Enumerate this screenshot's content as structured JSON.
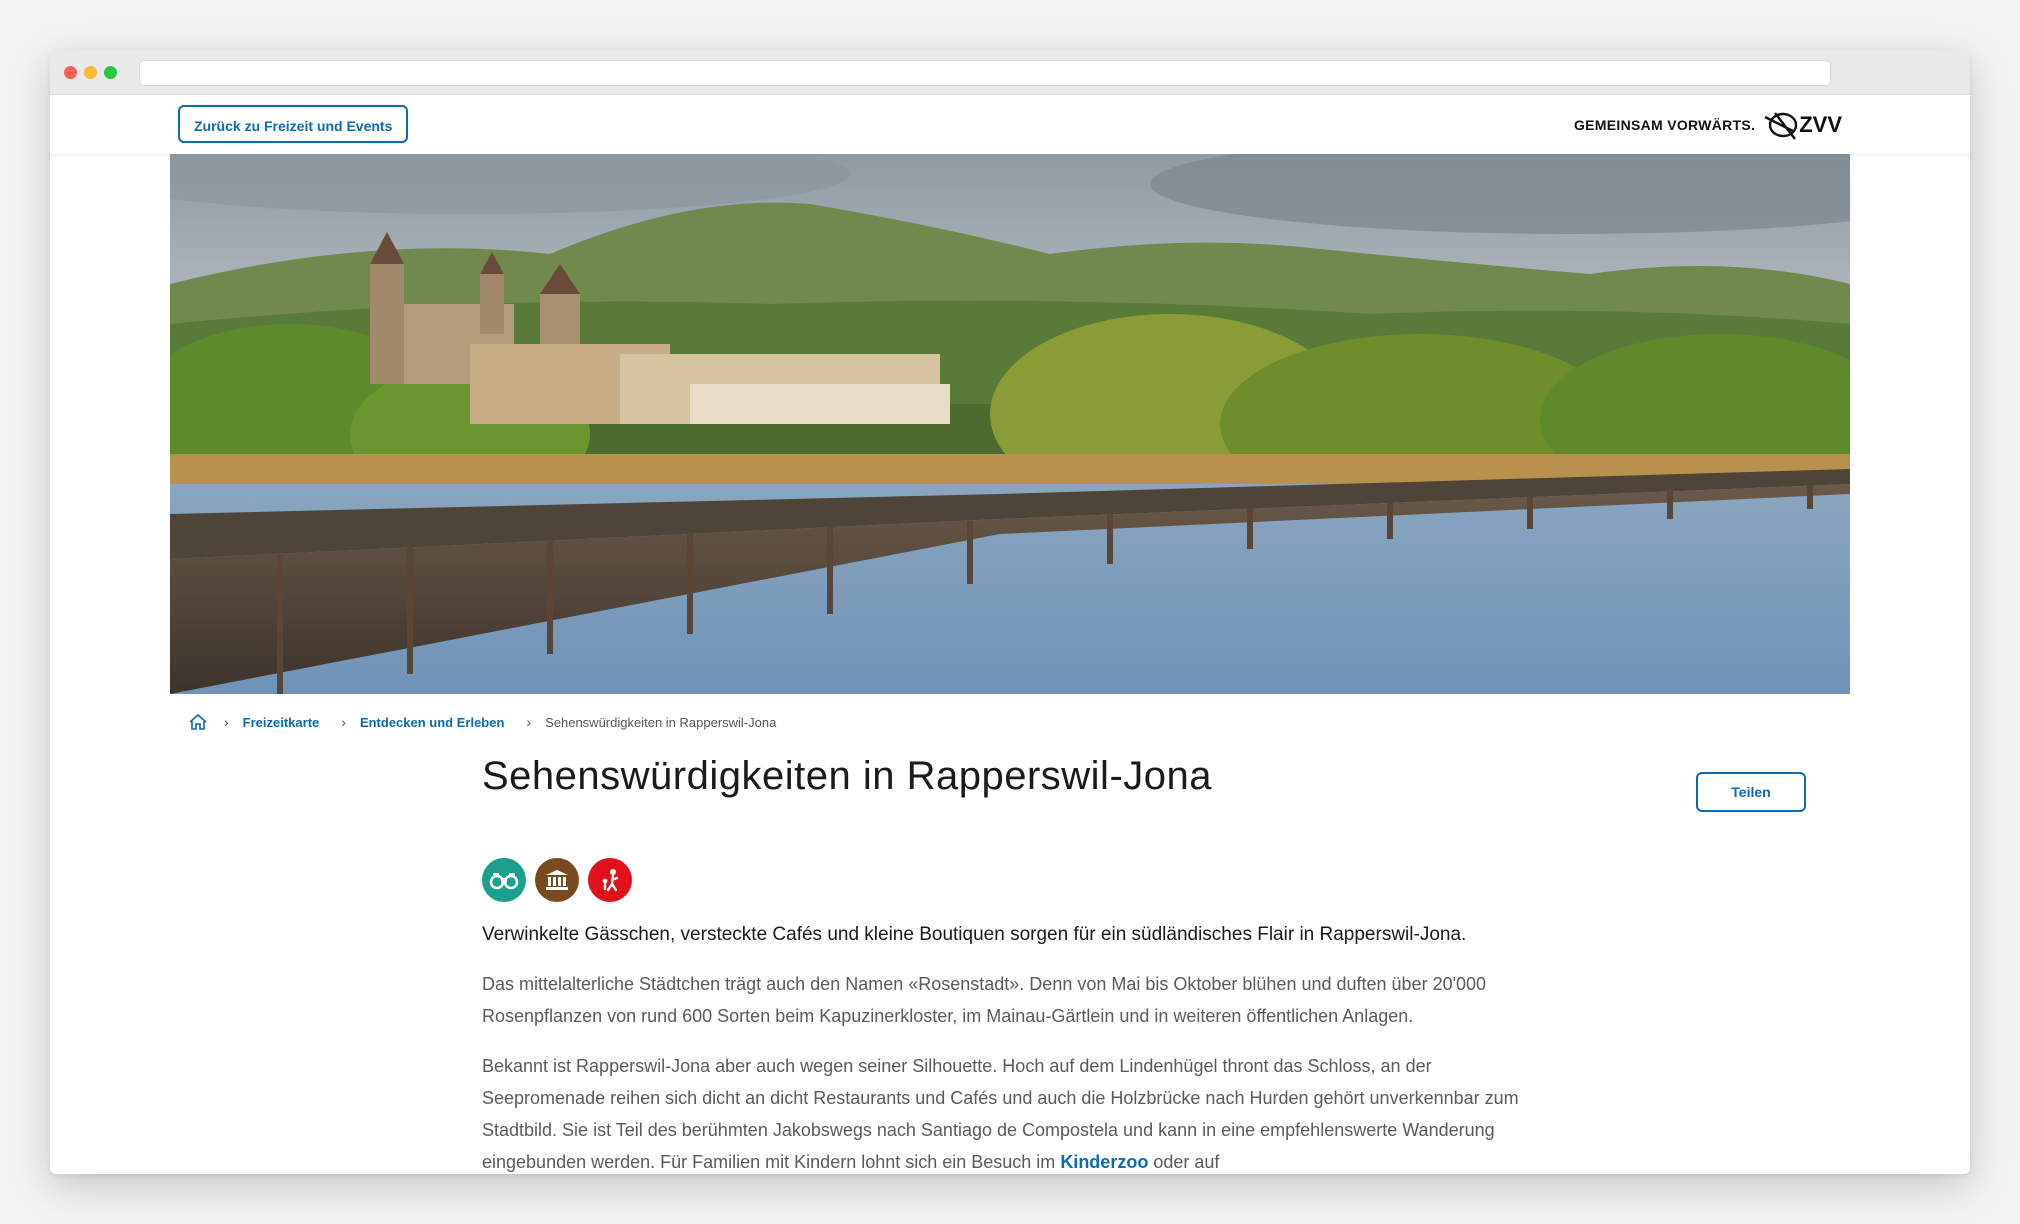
{
  "header": {
    "back_label": "Zurück zu Freizeit und Events",
    "tagline": "GEMEINSAM VORWÄRTS.",
    "logo_text": "ZVV"
  },
  "breadcrumb": {
    "items": [
      "Freizeitkarte",
      "Entdecken und Erleben"
    ],
    "current": "Sehenswürdigkeiten in Rapperswil-Jona"
  },
  "page": {
    "title": "Sehenswürdigkeiten in Rapperswil-Jona",
    "share_label": "Teilen",
    "categories": [
      {
        "icon": "binoculars-icon",
        "color": "#1aa08c"
      },
      {
        "icon": "museum-icon",
        "color": "#7a4a1e"
      },
      {
        "icon": "family-icon",
        "color": "#e0111b"
      }
    ],
    "lead": "Verwinkelte Gässchen, versteckte Cafés und kleine Boutiquen sorgen für ein südländisches Flair in Rapperswil-Jona.",
    "paragraph1": "Das mittelalterliche Städtchen trägt auch den Namen «Rosenstadt». Denn von Mai bis Oktober blühen und duften über 20'000 Rosenpflanzen von rund 600 Sorten beim Kapuzinerkloster, im Mainau-Gärtlein und in weiteren öffentlichen Anlagen.",
    "paragraph2_pre": "Bekannt ist Rapperswil-Jona aber auch wegen seiner Silhouette. Hoch auf dem Lindenhügel thront das Schloss, an der Seepromenade reihen sich dicht an dicht Restaurants und Cafés und auch die Holzbrücke nach Hurden gehört unverkennbar zum Stadtbild. Sie ist Teil des berühmten Jakobswegs nach Santiago de Compostela und kann in eine empfehlenswerte Wanderung eingebunden werden. Für Familien mit Kindern lohnt sich ein Besuch im ",
    "paragraph2_link": "Kinderzoo",
    "paragraph2_post": " oder auf"
  },
  "colors": {
    "accent": "#0a6bb3",
    "text": "#1a1a1a",
    "muted": "#5a5a5a"
  }
}
